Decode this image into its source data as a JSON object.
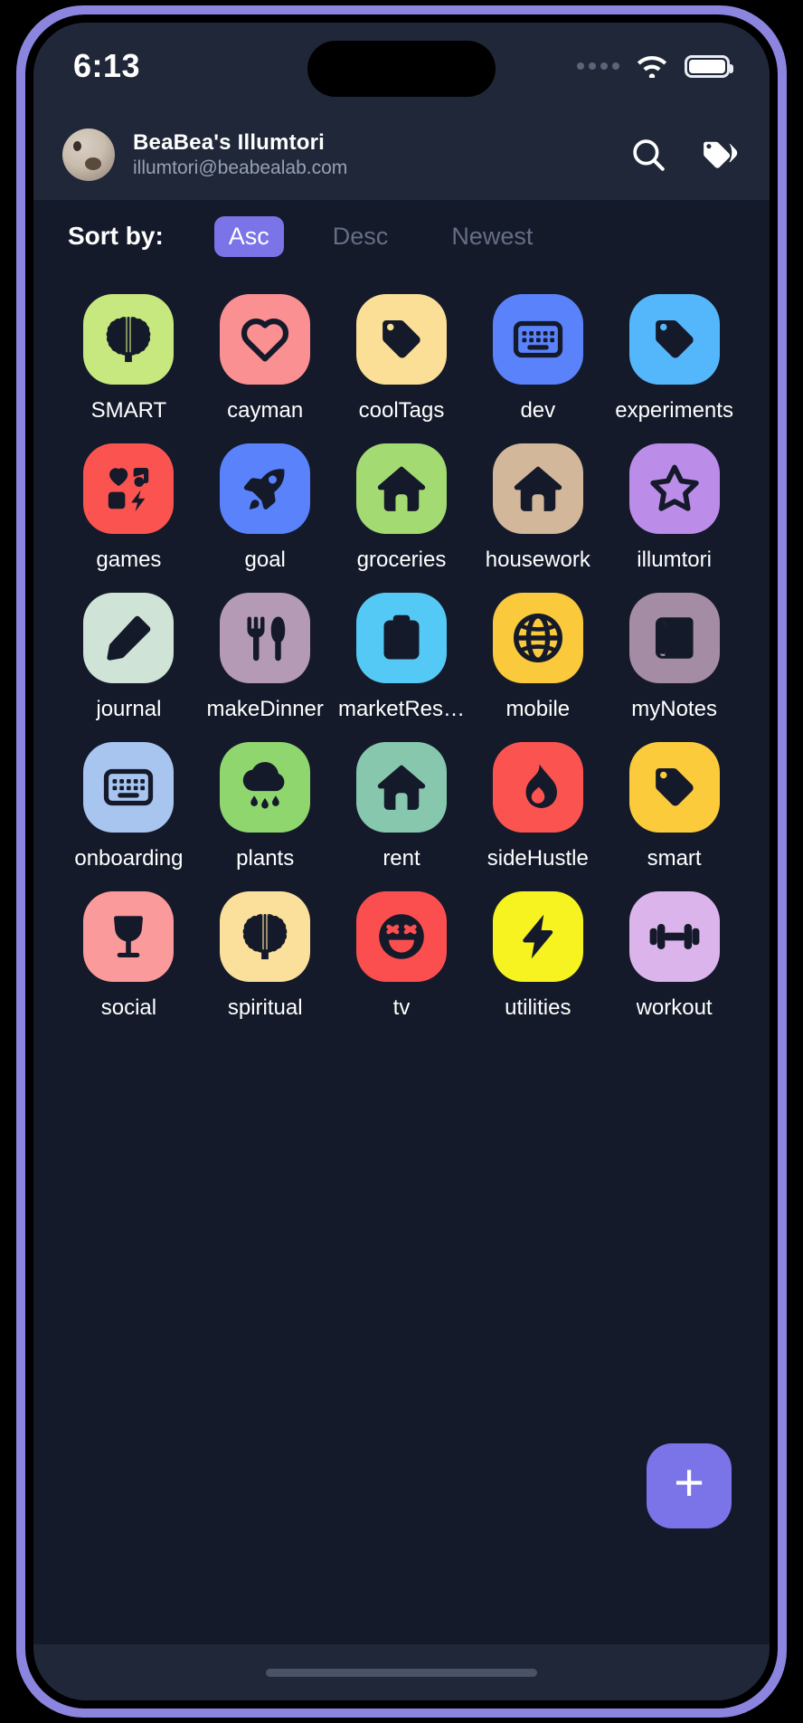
{
  "status_bar": {
    "time": "6:13",
    "signal_icon": "signal-dots-icon",
    "wifi_icon": "wifi-icon",
    "battery_icon": "battery-icon"
  },
  "header": {
    "avatar_icon": "avatar",
    "account_name": "BeaBea's Illumtori",
    "account_email": "illumtori@beabealab.com",
    "search_icon": "search-icon",
    "tag_icon": "tag-icon"
  },
  "sort": {
    "label": "Sort by:",
    "active": "Asc",
    "options": [
      {
        "label": "Asc",
        "active": true
      },
      {
        "label": "Desc",
        "active": false
      },
      {
        "label": "Newest",
        "active": false
      }
    ]
  },
  "colors": {
    "accent": "#7b74e8",
    "frame": "#8b85e0",
    "screen_bg": "#141a2a",
    "bar_bg": "#1f2738",
    "label_text": "#ffffff",
    "muted_text": "#656e84",
    "icon_glyph": "#141a2a"
  },
  "tags": [
    {
      "label": "SMART",
      "icon": "brain-icon",
      "bg": "#c7e87f"
    },
    {
      "label": "cayman",
      "icon": "heart-icon",
      "bg": "#fb9092"
    },
    {
      "label": "coolTags",
      "icon": "tag-icon",
      "bg": "#fbdf96"
    },
    {
      "label": "dev",
      "icon": "keyboard-icon",
      "bg": "#5a82fb"
    },
    {
      "label": "experiments",
      "icon": "tag-icon",
      "bg": "#55b7fb"
    },
    {
      "label": "games",
      "icon": "games-icon",
      "bg": "#fb5450"
    },
    {
      "label": "goal",
      "icon": "rocket-icon",
      "bg": "#5a82fb"
    },
    {
      "label": "groceries",
      "icon": "home-icon",
      "bg": "#a3da72"
    },
    {
      "label": "housework",
      "icon": "home-icon",
      "bg": "#d2b79b"
    },
    {
      "label": "illumtori",
      "icon": "star-icon",
      "bg": "#bb8ce8"
    },
    {
      "label": "journal",
      "icon": "pencil-icon",
      "bg": "#cfe4d6"
    },
    {
      "label": "makeDinner",
      "icon": "cutlery-icon",
      "bg": "#b49ab4"
    },
    {
      "label": "marketRes…",
      "icon": "clipboard-icon",
      "bg": "#55c9f5"
    },
    {
      "label": "mobile",
      "icon": "globe-icon",
      "bg": "#fbc93c"
    },
    {
      "label": "myNotes",
      "icon": "book-icon",
      "bg": "#a58ca5"
    },
    {
      "label": "onboarding",
      "icon": "keyboard-icon",
      "bg": "#a8c5f0"
    },
    {
      "label": "plants",
      "icon": "rain-cloud-icon",
      "bg": "#8fd66f"
    },
    {
      "label": "rent",
      "icon": "home-icon",
      "bg": "#87c7ae"
    },
    {
      "label": "sideHustle",
      "icon": "flame-icon",
      "bg": "#fb5450"
    },
    {
      "label": "smart",
      "icon": "tag-icon",
      "bg": "#fbcb3c"
    },
    {
      "label": "social",
      "icon": "wine-glass-icon",
      "bg": "#fb9a9a"
    },
    {
      "label": "spiritual",
      "icon": "brain-icon",
      "bg": "#fbe09c"
    },
    {
      "label": "tv",
      "icon": "laughing-face-icon",
      "bg": "#fb4f4f"
    },
    {
      "label": "utilities",
      "icon": "bolt-icon",
      "bg": "#f7f320"
    },
    {
      "label": "workout",
      "icon": "dumbbell-icon",
      "bg": "#dcb4ec"
    }
  ],
  "fab": {
    "label": "+",
    "icon": "plus-icon"
  },
  "bottom": {
    "home_indicator": "home-indicator"
  }
}
